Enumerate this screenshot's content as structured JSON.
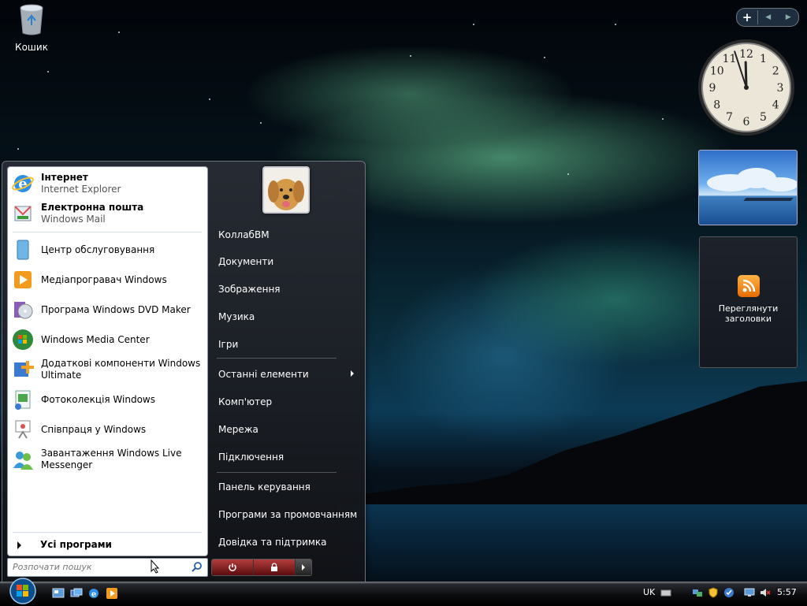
{
  "desktop": {
    "recycle_bin_label": "Кошик"
  },
  "gadgets": {
    "clock": {
      "hour": 11,
      "minute": 57,
      "numbers": [
        "12",
        "1",
        "2",
        "3",
        "4",
        "5",
        "6",
        "7",
        "8",
        "9",
        "10",
        "11"
      ]
    },
    "feeds_label": "Переглянути заголовки",
    "feeds_icon": "rss-icon"
  },
  "start_menu": {
    "pinned": [
      {
        "title": "Інтернет",
        "subtitle": "Internet Explorer",
        "icon": "internet-explorer-icon"
      },
      {
        "title": "Електронна пошта",
        "subtitle": "Windows Mail",
        "icon": "windows-mail-icon"
      }
    ],
    "recent": [
      {
        "line1": "Центр обслуговування",
        "line2": "",
        "icon": "welcome-center-icon"
      },
      {
        "line1": "Медіапрогравач Windows",
        "line2": "",
        "icon": "media-player-icon"
      },
      {
        "line1": "Програма Windows DVD Maker",
        "line2": "",
        "icon": "dvd-maker-icon"
      },
      {
        "line1": "Windows Media Center",
        "line2": "",
        "icon": "media-center-icon"
      },
      {
        "line1": "Додаткові компоненти Windows",
        "line2": "Ultimate",
        "icon": "ultimate-extras-icon"
      },
      {
        "line1": "Фотоколекція Windows",
        "line2": "",
        "icon": "photo-gallery-icon"
      },
      {
        "line1": "Співпраця у Windows",
        "line2": "",
        "icon": "meeting-space-icon"
      },
      {
        "line1": "Завантаження Windows Live",
        "line2": "Messenger",
        "icon": "live-messenger-icon"
      }
    ],
    "all_programs": "Усі програми",
    "search_placeholder": "Розпочати пошук",
    "right_items": [
      "КоллабВМ",
      "Документи",
      "Зображення",
      "Музика",
      "Ігри",
      "Останні елементи",
      "Комп'ютер",
      "Мережа",
      "Підключення",
      "Панель керування",
      "Програми за промовчанням",
      "Довідка та підтримка"
    ]
  },
  "taskbar": {
    "language": "UK",
    "time": "5:57",
    "quick_launch": [
      "show-desktop-icon",
      "switch-windows-icon",
      "internet-explorer-icon",
      "media-player-icon"
    ]
  },
  "colors": {
    "accent_green": "#4caf6a",
    "power_red": "#b33c3c",
    "rss_orange": "#f08a24"
  }
}
